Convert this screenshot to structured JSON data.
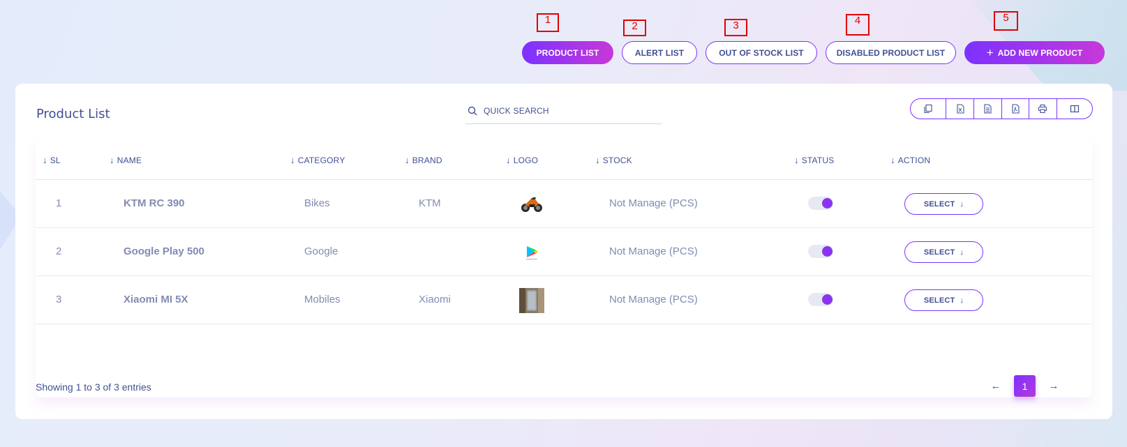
{
  "top_nav": {
    "product_list": "PRODUCT LIST",
    "alert_list": "ALERT LIST",
    "out_of_stock_list": "OUT OF STOCK LIST",
    "disabled_product_list": "DISABLED PRODUCT LIST",
    "add_new_product": "ADD NEW PRODUCT",
    "plus_glyph": "+"
  },
  "markers": [
    "1",
    "2",
    "3",
    "4",
    "5"
  ],
  "card": {
    "title": "Product List",
    "search_placeholder": "QUICK SEARCH",
    "tools": [
      "copy-icon",
      "excel-icon",
      "csv-icon",
      "pdf-icon",
      "print-icon",
      "columns-icon"
    ]
  },
  "table": {
    "headers": [
      "SL",
      "NAME",
      "CATEGORY",
      "BRAND",
      "LOGO",
      "STOCK",
      "STATUS",
      "ACTION"
    ],
    "rows": [
      {
        "sl": "1",
        "name": "KTM RC 390",
        "category": "Bikes",
        "brand": "KTM",
        "logo": "motorcycle-image",
        "stock": "Not Manage (PCS)",
        "status": true,
        "action": "SELECT"
      },
      {
        "sl": "2",
        "name": "Google Play 500",
        "category": "Google",
        "brand": "",
        "logo": "google-play-logo",
        "stock": "Not Manage (PCS)",
        "status": true,
        "action": "SELECT"
      },
      {
        "sl": "3",
        "name": "Xiaomi MI 5X",
        "category": "Mobiles",
        "brand": "Xiaomi",
        "logo": "phone-image",
        "stock": "Not Manage (PCS)",
        "status": true,
        "action": "SELECT"
      }
    ]
  },
  "footer": {
    "info": "Showing 1 to 3 of 3 entries",
    "current_page": "1"
  },
  "colors": {
    "accent": "#7c32ff",
    "accent_end": "#c738d8",
    "text": "#415094",
    "muted": "#828bb2",
    "marker": "#e00000"
  }
}
